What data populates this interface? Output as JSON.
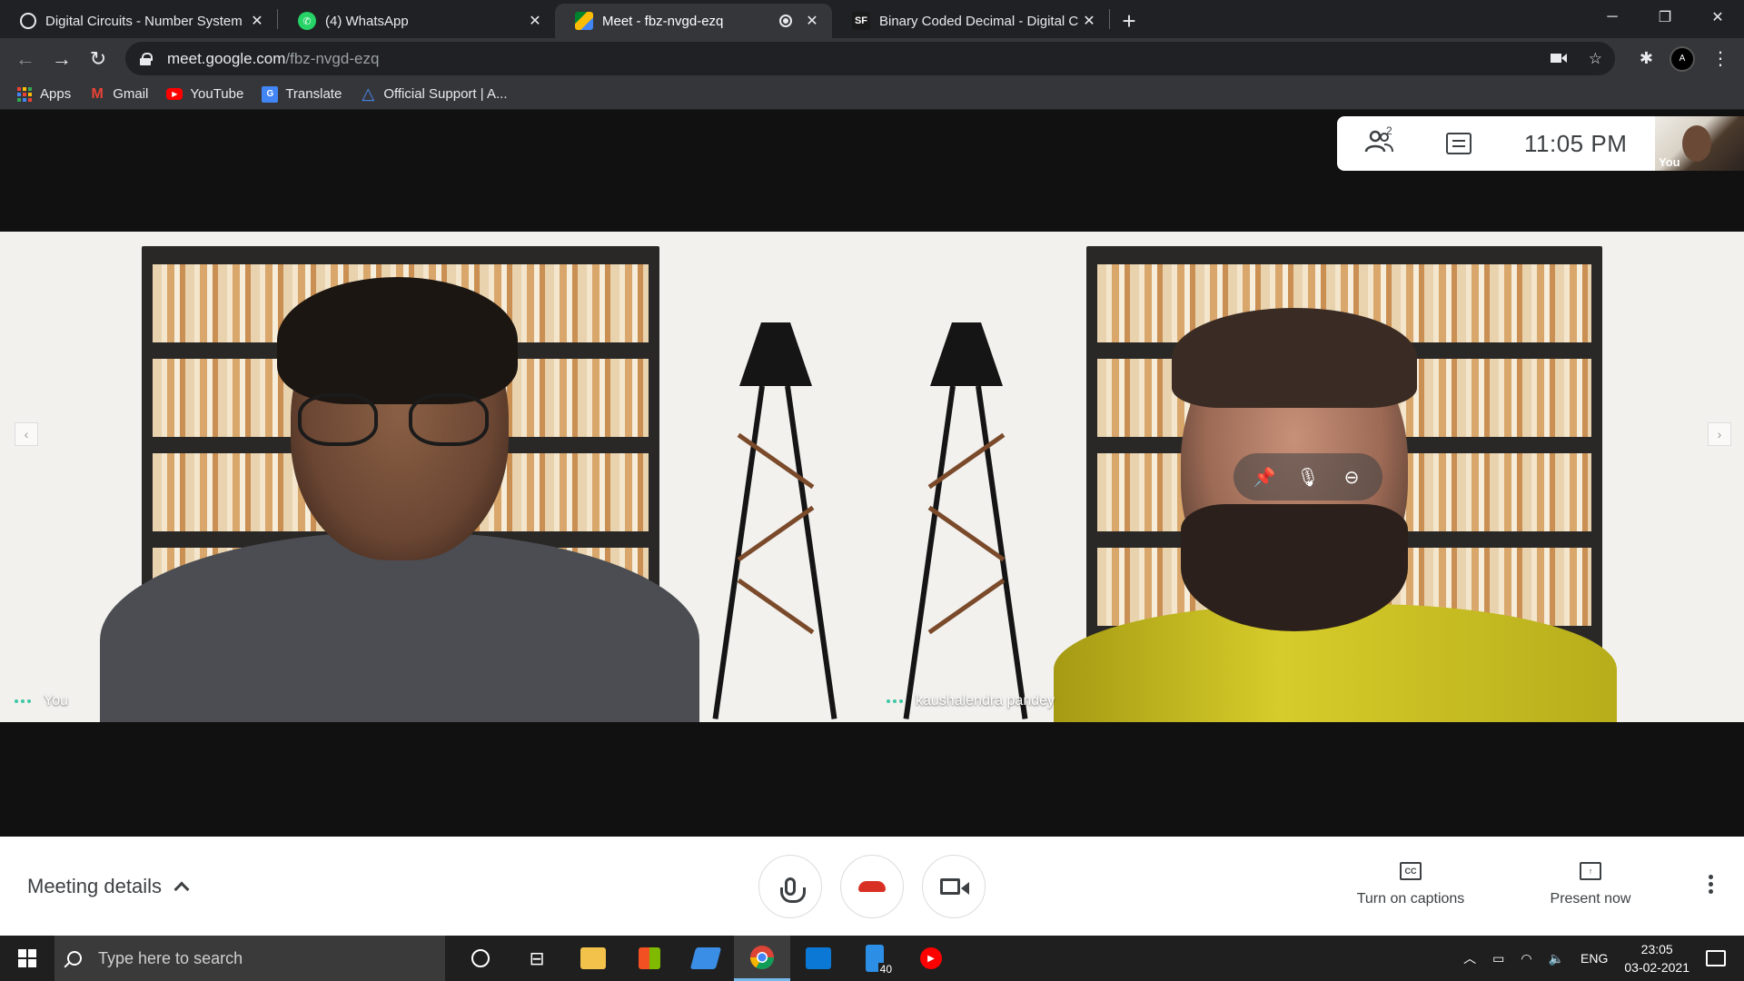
{
  "browser": {
    "tabs": [
      {
        "title": "Digital Circuits - Number System",
        "favicon": "gear-like-logo-icon",
        "active": false
      },
      {
        "title": "(4) WhatsApp",
        "favicon": "whatsapp-icon",
        "active": false
      },
      {
        "title": "Meet - fbz-nvgd-ezq",
        "favicon": "google-meet-icon",
        "active": true
      },
      {
        "title": "Binary Coded Decimal - Digital C",
        "favicon": "SF",
        "active": false
      }
    ],
    "url_host": "meet.google.com",
    "url_path": "/fbz-nvgd-ezq",
    "profile_initial": "A",
    "bookmarks": [
      {
        "label": "Apps",
        "icon": "apps-grid-icon"
      },
      {
        "label": "Gmail",
        "icon": "gmail-icon"
      },
      {
        "label": "YouTube",
        "icon": "youtube-icon"
      },
      {
        "label": "Translate",
        "icon": "translate-icon"
      },
      {
        "label": "Official Support | A...",
        "icon": "support-icon"
      }
    ]
  },
  "meet": {
    "participant_count": "2",
    "clock": "11:05  PM",
    "self_thumb_label": "You",
    "participants": [
      {
        "name": "You"
      },
      {
        "name": "kaushalendra pandey"
      }
    ],
    "meeting_details": "Meeting details",
    "captions_label": "Turn on captions",
    "present_label": "Present now",
    "captions_icon_text": "CC"
  },
  "taskbar": {
    "search_placeholder": "Type here to search",
    "badge_count": "40",
    "lang": "ENG",
    "time": "23:05",
    "date": "03-02-2021"
  },
  "colors": {
    "end_call": "#d93025",
    "speaking_dots": "#3ec7a5",
    "taskbar_active_underline": "#76b9ed"
  }
}
